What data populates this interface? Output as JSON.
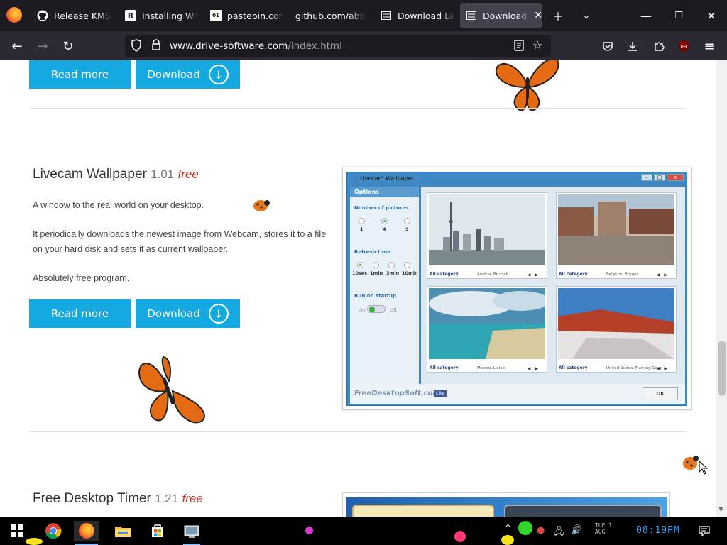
{
  "browser": {
    "tabs": [
      {
        "label": "Release KMSp",
        "icon": "github-icon"
      },
      {
        "label": "Installing Wine",
        "icon": "r-icon"
      },
      {
        "label": "pastebin.com/",
        "icon": "pastebin-icon"
      },
      {
        "label": "github.com/abbo",
        "icon": "none"
      },
      {
        "label": "Download Lad",
        "icon": "page-icon"
      },
      {
        "label": "Download A",
        "icon": "page-icon",
        "active": true
      }
    ],
    "url_domain": "www.drive-software.com",
    "url_path": "/index.html",
    "extension_badge": "5"
  },
  "buttons": {
    "read_more": "Read more",
    "download": "Download"
  },
  "product1": {
    "name": "Livecam Wallpaper",
    "version": "1.01",
    "free": "free",
    "para1": "A window to the real world on your desktop.",
    "para2": "It periodically downloads the newest image from Webcam, stores it to a file on your hard disk and sets it as current wallpaper.",
    "para3": "Absolutely free program."
  },
  "screenshot": {
    "window_title": "Livecam Wallpaper",
    "options": "Options",
    "num_pictures": "Number of pictures",
    "num_values": [
      "1",
      "4",
      "9"
    ],
    "refresh_time": "Refresh time",
    "refresh_values": [
      "10sec",
      "1min",
      "3min",
      "10min"
    ],
    "run_on_startup": "Run on startup",
    "toggle_on": "On",
    "toggle_off": "Off",
    "cells": [
      {
        "category": "All category",
        "location": "Austria, Brunick"
      },
      {
        "category": "All category",
        "location": "Belgium, Bruges"
      },
      {
        "category": "All category",
        "location": "Mexico, La Isla"
      },
      {
        "category": "All category",
        "location": "United States, Flaming Gorg"
      }
    ],
    "brand": "FreeDesktopSoft.com",
    "like": "Like",
    "ok": "OK"
  },
  "product2": {
    "name": "Free Desktop Timer",
    "version": "1.21",
    "free": "free"
  },
  "taskbar": {
    "date_line1": "TUE 1",
    "date_line2": "AUG",
    "clock": "08:19PM"
  }
}
